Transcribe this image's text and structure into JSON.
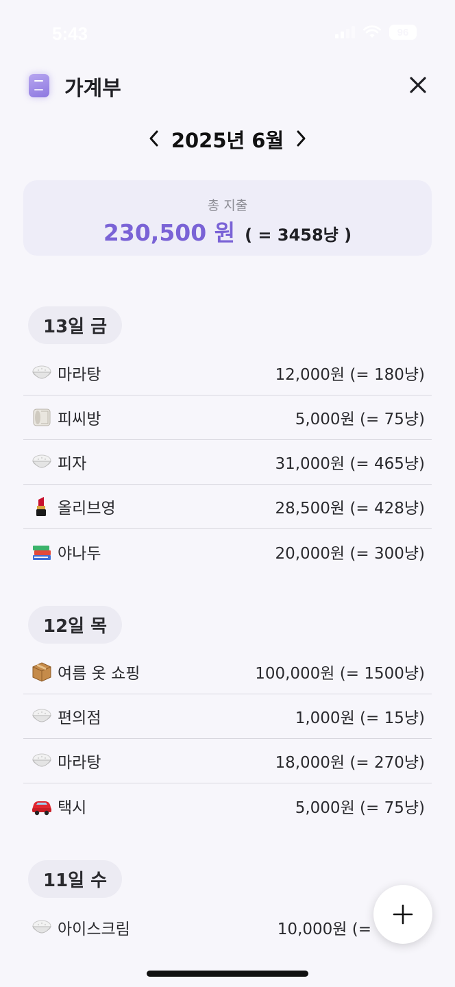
{
  "status_bar": {
    "time": "5:43",
    "battery": "96"
  },
  "header": {
    "title": "가계부"
  },
  "month_nav": {
    "label": "2025년 6월"
  },
  "summary": {
    "label": "총 지출",
    "amount": "230,500 원",
    "nyang": "( = 3458냥 )"
  },
  "days": [
    {
      "label": "13일 금",
      "items": [
        {
          "icon": "rice-bowl-icon",
          "name": "마라탕",
          "amount": "12,000원 (= 180냥)"
        },
        {
          "icon": "tissue-roll-icon",
          "name": "피씨방",
          "amount": "5,000원 (= 75냥)"
        },
        {
          "icon": "rice-bowl-icon",
          "name": "피자",
          "amount": "31,000원 (= 465냥)"
        },
        {
          "icon": "lipstick-icon",
          "name": "올리브영",
          "amount": "28,500원 (= 428냥)"
        },
        {
          "icon": "books-icon",
          "name": "야나두",
          "amount": "20,000원 (= 300냥)"
        }
      ]
    },
    {
      "label": "12일 목",
      "items": [
        {
          "icon": "package-icon",
          "name": "여름 옷 쇼핑",
          "amount": "100,000원 (= 1500냥)"
        },
        {
          "icon": "rice-bowl-icon",
          "name": "편의점",
          "amount": "1,000원 (= 15냥)"
        },
        {
          "icon": "rice-bowl-icon",
          "name": "마라탕",
          "amount": "18,000원 (= 270냥)"
        },
        {
          "icon": "car-icon",
          "name": "택시",
          "amount": "5,000원 (= 75냥)"
        }
      ]
    },
    {
      "label": "11일 수",
      "items": [
        {
          "icon": "rice-bowl-icon",
          "name": "아이스크림",
          "amount": "10,000원 (="
        }
      ]
    }
  ],
  "colors": {
    "accent": "#7a63d6",
    "background": "#f7f6fb",
    "card": "#eeedf8",
    "chip": "#ecebf3",
    "divider": "#d8d7de"
  }
}
